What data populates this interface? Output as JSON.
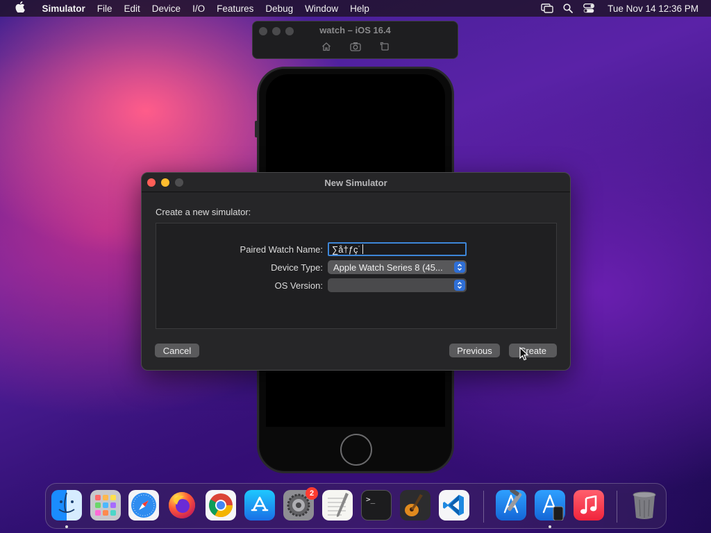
{
  "menubar": {
    "app_name": "Simulator",
    "items": [
      "File",
      "Edit",
      "Device",
      "I/O",
      "Features",
      "Debug",
      "Window",
      "Help"
    ],
    "clock": "Tue Nov 14  12:36 PM",
    "icons": [
      "apple-icon",
      "screen-mirroring-icon",
      "spotlight-search-icon",
      "control-center-icon"
    ]
  },
  "simulator_window": {
    "title": "watch – iOS 16.4",
    "tool_icons": [
      "home-icon",
      "screenshot-icon",
      "rotate-icon"
    ]
  },
  "dialog": {
    "title": "New Simulator",
    "heading": "Create a new simulator:",
    "fields": {
      "paired_watch_name": {
        "label": "Paired Watch Name:",
        "value": "∑å†ƒç˙"
      },
      "device_type": {
        "label": "Device Type:",
        "value": "Apple Watch Series 8 (45..."
      },
      "os_version": {
        "label": "OS Version:",
        "value": ""
      }
    },
    "buttons": {
      "cancel": "Cancel",
      "previous": "Previous",
      "create": "Create"
    }
  },
  "dock": {
    "apps": [
      {
        "name": "Finder",
        "icon": "finder-icon",
        "running": true
      },
      {
        "name": "Launchpad",
        "icon": "launchpad-icon",
        "running": false
      },
      {
        "name": "Safari",
        "icon": "safari-icon",
        "running": false
      },
      {
        "name": "Firefox",
        "icon": "firefox-icon",
        "running": false
      },
      {
        "name": "Chrome",
        "icon": "chrome-icon",
        "running": false
      },
      {
        "name": "App Store",
        "icon": "app-store-icon",
        "running": false
      },
      {
        "name": "System Settings",
        "icon": "system-settings-icon",
        "running": false,
        "badge": "2"
      },
      {
        "name": "TextEdit",
        "icon": "textedit-icon",
        "running": false
      },
      {
        "name": "Terminal",
        "icon": "terminal-icon",
        "running": false
      },
      {
        "name": "GarageBand",
        "icon": "garageband-icon",
        "running": false
      },
      {
        "name": "Visual Studio Code",
        "icon": "vscode-icon",
        "running": false
      },
      {
        "name": "Xcode",
        "icon": "xcode-icon",
        "running": false
      },
      {
        "name": "Simulator",
        "icon": "simulator-icon",
        "running": true
      },
      {
        "name": "Music",
        "icon": "music-icon",
        "running": false
      },
      {
        "name": "Trash",
        "icon": "trash-icon",
        "running": false
      }
    ],
    "terminal_prompt": ">_"
  },
  "colors": {
    "accent_blue": "#3d86d8",
    "close_red": "#ff5f57",
    "minimize_yellow": "#febc2e",
    "badge_red": "#ff3b30"
  }
}
